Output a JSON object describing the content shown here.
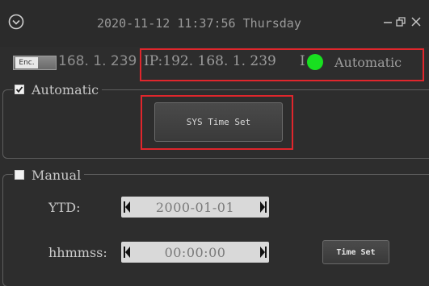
{
  "titlebar": {
    "app_icon": "circle-chevron-down-icon",
    "datetime_text": "2020-11-12 11:37:56 Thursday",
    "minimize_icon": "minimize-icon",
    "restore_icon": "restore-icon",
    "close_icon": "close-icon"
  },
  "status": {
    "enc_label": "Enc.",
    "partial_ip": "168. 1. 239",
    "ip_text": "IP:192. 168. 1. 239",
    "indicator_prefix": "I",
    "indicator_color": "#18e020",
    "mode_text": "Automatic",
    "highlight_color": "#e0262c"
  },
  "auto_group": {
    "title": "Automatic",
    "checked": true,
    "sys_time_set_label": "SYS Time Set"
  },
  "manual_group": {
    "title": "Manual",
    "checked": false,
    "ytd_label": "YTD:",
    "ytd_value": "2000-01-01",
    "time_label": "hhmmss:",
    "time_value": "00:00:00",
    "time_set_label": "Time Set"
  }
}
